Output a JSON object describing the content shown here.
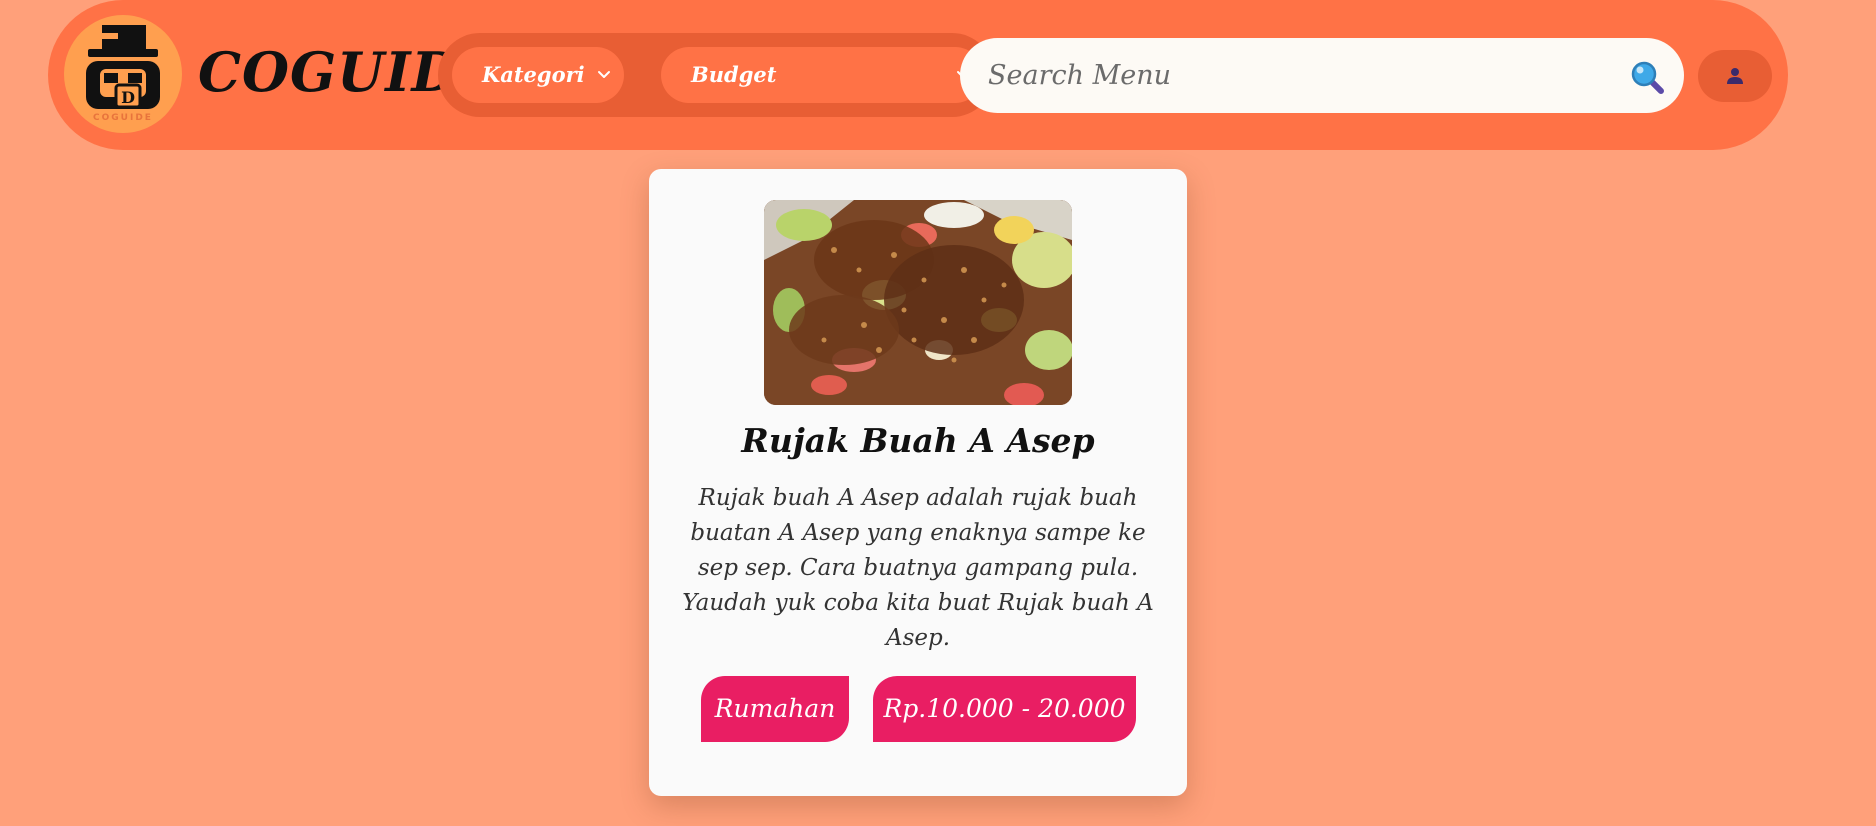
{
  "header": {
    "brand_name": "COGUIDE",
    "logo_caption": "COGUIDE",
    "filters": {
      "category_label": "Kategori",
      "budget_label": "Budget"
    },
    "search": {
      "placeholder": "Search Menu",
      "value": ""
    },
    "icons": {
      "search": "search-icon",
      "user": "user-icon",
      "chevron": "chevron-down-icon"
    }
  },
  "card": {
    "title": "Rujak Buah A Asep",
    "description": "Rujak buah A Asep adalah rujak buah buatan A Asep yang enaknya sampe ke sep sep. Cara buatnya gampang pula. Yaudah yuk coba kita buat Rujak buah A Asep.",
    "tags": {
      "category": "Rumahan",
      "price": "Rp.10.000 - 20.000"
    }
  },
  "colors": {
    "page_background": "#FFA07A",
    "header_background": "#FF7246",
    "filter_group_background": "#E85E34",
    "tag_background": "#E91E63",
    "card_background": "#FAFAFA"
  }
}
